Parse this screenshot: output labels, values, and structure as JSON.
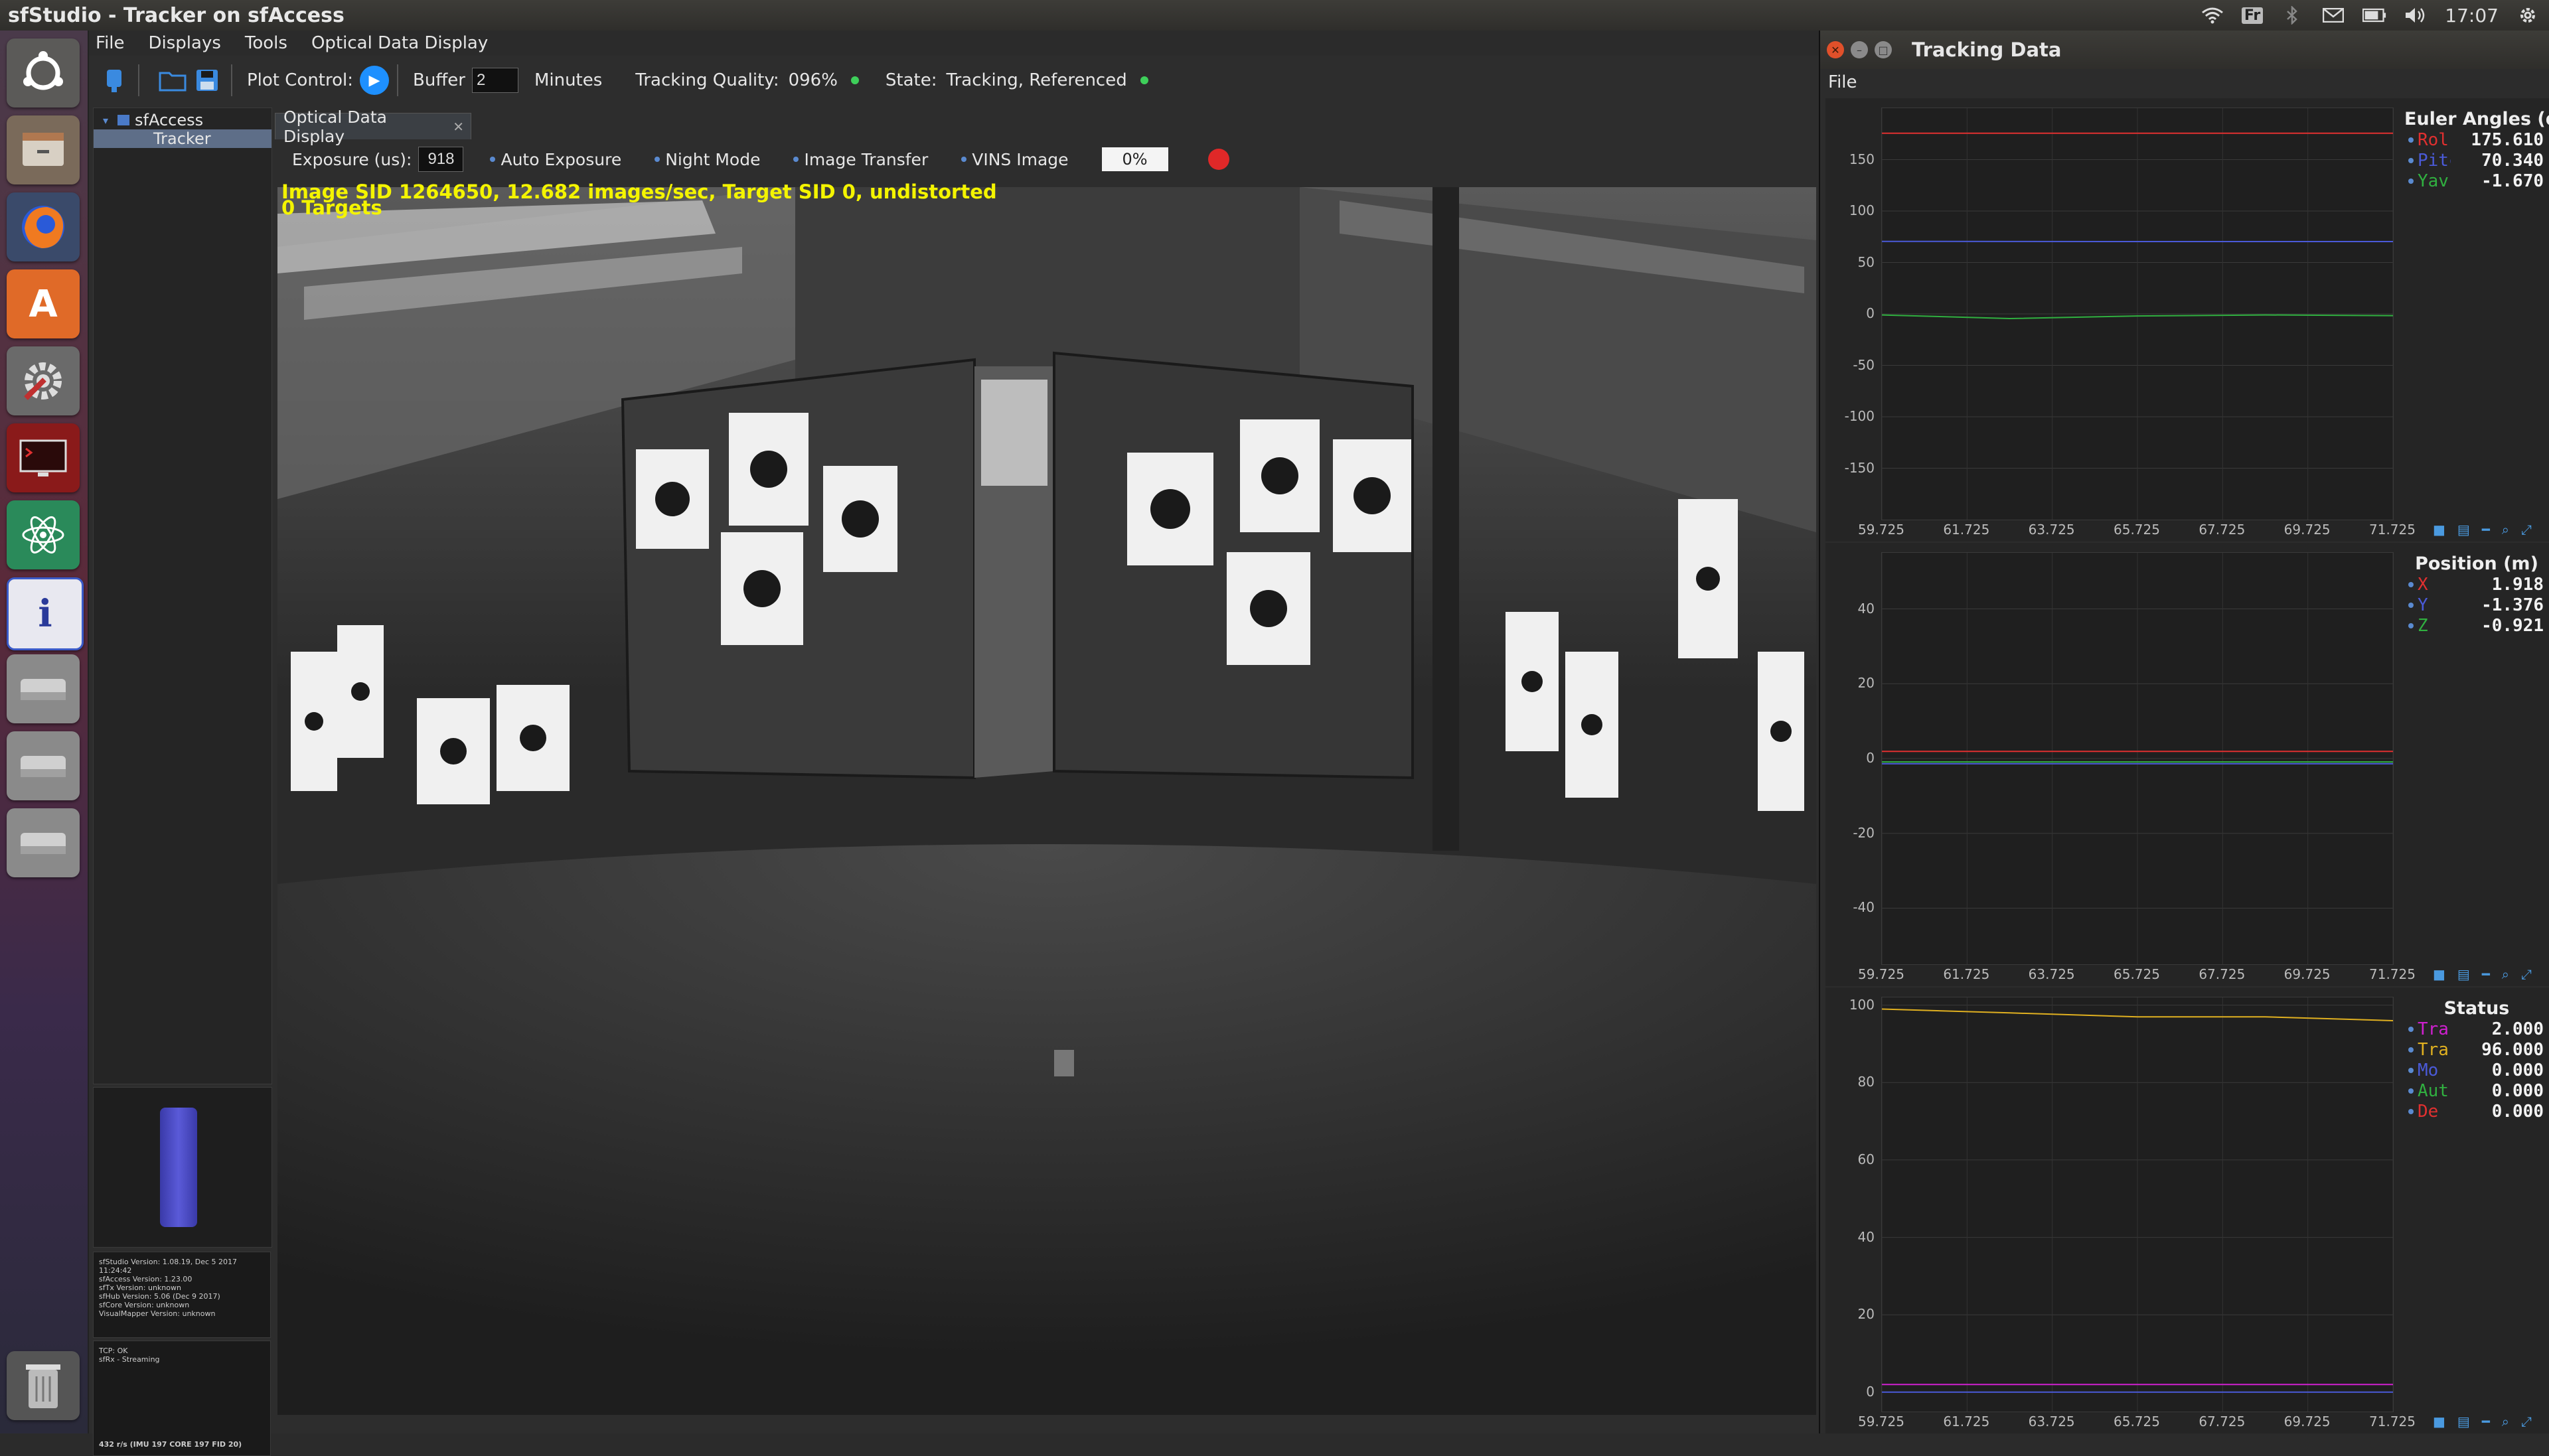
{
  "window_title": "sfStudio - Tracker on sfAccess",
  "system_tray": {
    "keyboard": "Fr",
    "time": "17:07"
  },
  "menu": [
    "File",
    "Displays",
    "Tools",
    "Optical Data Display"
  ],
  "toolbar": {
    "plot_control_label": "Plot Control:",
    "buffer_label": "Buffer",
    "buffer_value": "2",
    "minutes_label": "Minutes",
    "tracking_quality_label": "Tracking Quality:",
    "tracking_quality_value": "096%",
    "state_label": "State:",
    "state_value": "Tracking, Referenced",
    "status_color": "#3ecf5a"
  },
  "tree": {
    "root": "sfAccess",
    "child": "Tracker"
  },
  "version_info": [
    "sfStudio Version: 1.08.19, Dec 5 2017",
    "11:24:42",
    "sfAccess Version: 1.23.00",
    "sfTx Version: unknown",
    "sfHub Version: 5.06 (Dec 9 2017)",
    "sfCore Version: unknown",
    "VisualMapper Version: unknown"
  ],
  "connection_status": [
    "TCP: OK",
    "sfRx - Streaming"
  ],
  "rate_line": "432 r/s (IMU 197 CORE 197 FID 20)",
  "optical": {
    "tab_label": "Optical Data Display",
    "exposure_label": "Exposure (us):",
    "exposure_value": "918",
    "auto_exposure": "Auto Exposure",
    "night_mode": "Night Mode",
    "image_transfer": "Image Transfer",
    "vins_image": "VINS Image",
    "progress_text": "0%",
    "record_color": "#e02828",
    "overlay_line1": "Image SID 1264650, 12.682 images/sec, Target SID 0, undistorted",
    "overlay_line2": "0 Targets"
  },
  "tracking_window": {
    "title": "Tracking Data",
    "menu_file": "File"
  },
  "plots": [
    {
      "title": "Euler Angles (de",
      "legend": [
        {
          "name": "Rol",
          "value": "175.610",
          "color": "#e03030"
        },
        {
          "name": "Pitc",
          "value": "70.340",
          "color": "#4a5ad8"
        },
        {
          "name": "Yav",
          "value": "-1.670",
          "color": "#30b040"
        }
      ],
      "yticks": [
        "150",
        "100",
        "50",
        "0",
        "-50",
        "-100",
        "-150"
      ],
      "chart_data": {
        "type": "line",
        "ylim": [
          -200,
          200
        ],
        "series": [
          {
            "name": "Rol",
            "color": "#e03030",
            "values": [
              175.6,
              175.6,
              175.6,
              175.6,
              175.6
            ]
          },
          {
            "name": "Pitc",
            "color": "#4a5ad8",
            "values": [
              70.5,
              70.4,
              70.3,
              70.3,
              70.3
            ]
          },
          {
            "name": "Yav",
            "color": "#30b040",
            "values": [
              -1.0,
              -4.5,
              -2.0,
              -1.0,
              -1.7
            ]
          }
        ]
      }
    },
    {
      "title": "Position (m)",
      "legend": [
        {
          "name": "X",
          "value": "1.918",
          "color": "#e03030"
        },
        {
          "name": "Y",
          "value": "-1.376",
          "color": "#4a5ad8"
        },
        {
          "name": "Z",
          "value": "-0.921",
          "color": "#30b040"
        }
      ],
      "yticks": [
        "40",
        "20",
        "0",
        "-20",
        "-40"
      ],
      "chart_data": {
        "type": "line",
        "ylim": [
          -55,
          55
        ],
        "series": [
          {
            "name": "X",
            "color": "#e03030",
            "values": [
              1.9,
              1.9,
              1.9,
              1.9,
              1.9
            ]
          },
          {
            "name": "Y",
            "color": "#4a5ad8",
            "values": [
              -1.4,
              -1.4,
              -1.4,
              -1.4,
              -1.4
            ]
          },
          {
            "name": "Z",
            "color": "#30b040",
            "values": [
              -0.9,
              -0.9,
              -0.9,
              -0.9,
              -0.9
            ]
          }
        ]
      }
    },
    {
      "title": "Status",
      "legend": [
        {
          "name": "Tra",
          "value": "2.000",
          "color": "#d020d0"
        },
        {
          "name": "Tra",
          "value": "96.000",
          "color": "#e0b020"
        },
        {
          "name": "Mo",
          "value": "0.000",
          "color": "#4a5ad8"
        },
        {
          "name": "Aut",
          "value": "0.000",
          "color": "#30b040"
        },
        {
          "name": "De",
          "value": "0.000",
          "color": "#e03030"
        }
      ],
      "yticks": [
        "100",
        "80",
        "60",
        "40",
        "20",
        "0"
      ],
      "chart_data": {
        "type": "line",
        "ylim": [
          -5,
          102
        ],
        "series": [
          {
            "name": "Tra",
            "color": "#d020d0",
            "values": [
              2,
              2,
              2,
              2,
              2
            ]
          },
          {
            "name": "Tra",
            "color": "#e0b020",
            "values": [
              99,
              98,
              97,
              97,
              96
            ]
          },
          {
            "name": "Mo",
            "color": "#4a5ad8",
            "values": [
              0,
              0,
              0,
              0,
              0
            ]
          }
        ]
      }
    }
  ],
  "xticks": [
    "59.725",
    "61.725",
    "63.725",
    "65.725",
    "67.725",
    "69.725",
    "71.725"
  ]
}
